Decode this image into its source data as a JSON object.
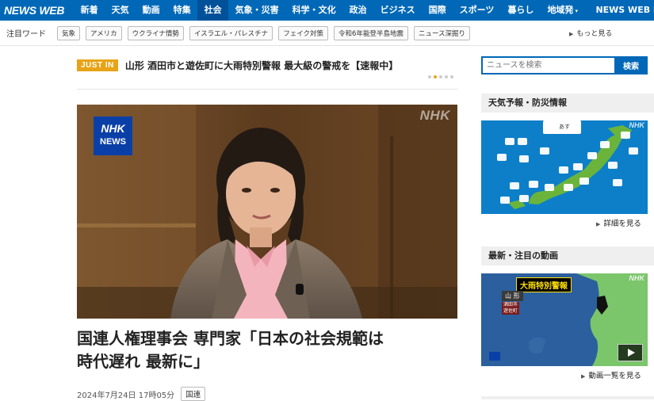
{
  "nav": {
    "logo": "NEWS WEB",
    "items": [
      "新着",
      "天気",
      "動画",
      "特集",
      "社会",
      "気象・災害",
      "科学・文化",
      "政治",
      "ビジネス",
      "国際",
      "スポーツ",
      "暮らし",
      "地域発"
    ],
    "active_index": 4,
    "region_caret": "▾",
    "easy": "NEWS WEB EASY"
  },
  "tags": {
    "label": "注目ワード",
    "items": [
      "気象",
      "アメリカ",
      "ウクライナ情勢",
      "イスラエル・パレスチナ",
      "フェイク対策",
      "令和6年能登半島地震",
      "ニュース深掘り"
    ],
    "more": "もっと見る"
  },
  "justin": {
    "badge": "JUST IN",
    "text": "山形 酒田市と遊佐町に大雨特別警報 最大級の警戒を【速報中】"
  },
  "hero": {
    "watermark": "NHK",
    "badge_line1": "NHK",
    "badge_line2": "NEWS"
  },
  "article": {
    "headline_line1": "国連人権理事会 専門家「日本の社会規範は",
    "headline_line2": "時代遅れ 最新に」",
    "date": "2024年7月24日 17時05分",
    "category": "国連"
  },
  "search": {
    "placeholder": "ニュースを検索",
    "button": "検索"
  },
  "weather": {
    "heading": "天気予報・防災情報",
    "map_watermark": "NHK",
    "map_tab": "あす",
    "link": "詳細を見る"
  },
  "video": {
    "heading": "最新・注目の動画",
    "watermark": "NHK",
    "alert_title": "大雨特別警報",
    "region": "山 形",
    "city1": "酒田市",
    "city2": "遊佐町",
    "link": "動画一覧を見る"
  },
  "colors": {
    "nav_blue": "#0068b7",
    "justin_orange": "#e8a317",
    "nav_active": "#00509a"
  }
}
